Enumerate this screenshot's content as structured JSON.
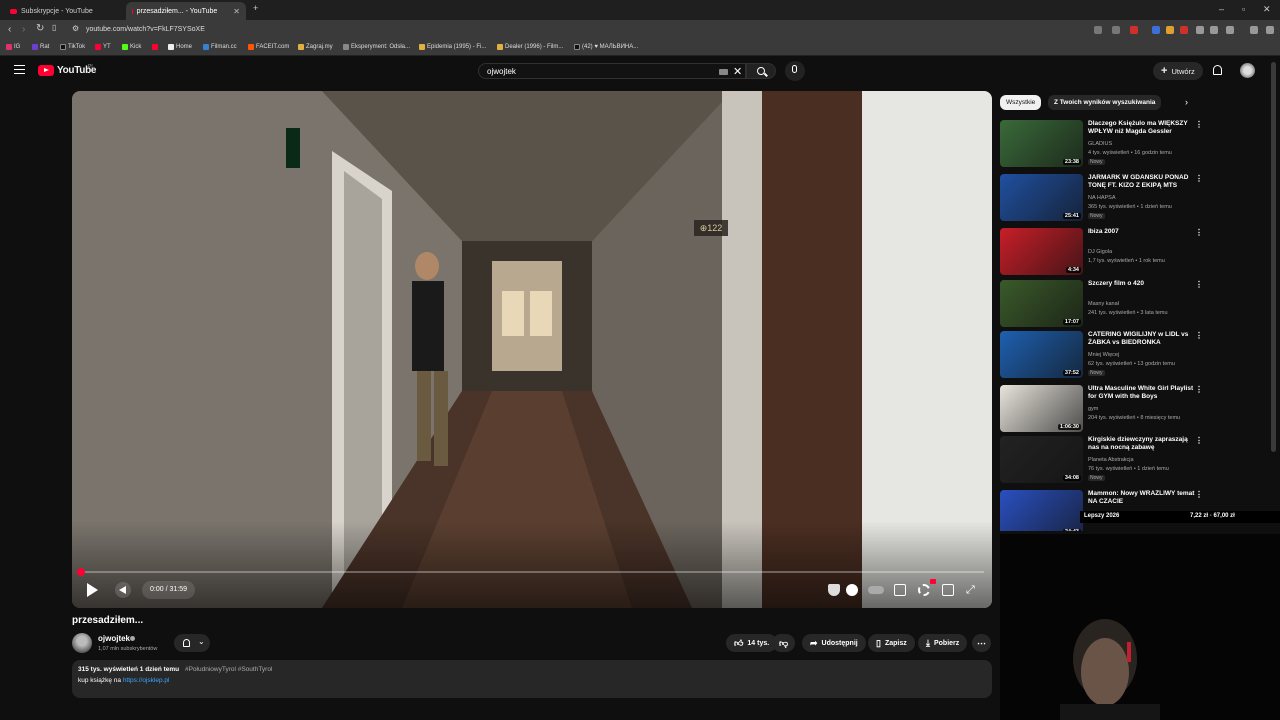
{
  "browser": {
    "tabs": [
      {
        "title": "Subskrypcje - YouTube"
      },
      {
        "title": "przesadziłem... - YouTube"
      }
    ],
    "url": "youtube.com/watch?v=FkLF7SYSoXE",
    "bookmarks": [
      "IG",
      "Rat",
      "TikTok",
      "YT",
      "Kick",
      "Home",
      "Filman.cc",
      "FACEIT.com",
      "Zagraj.my",
      "Eksperyment: Odsła...",
      "Epidemia (1995) - Fi...",
      "Dealer (1996) - Film...",
      "(42) ♥ МАЛЬВИНА..."
    ]
  },
  "header": {
    "logo_text": "YouTube",
    "logo_country": "PL",
    "search_value": "ojwojtek",
    "create_label": "Utwórz"
  },
  "player": {
    "time": "0:00 / 31:59",
    "progress": 0.0,
    "room_sign": "122"
  },
  "video": {
    "title": "przesadziłem...",
    "channel": "ojwojtek",
    "subscribers": "1,07 mln subskrybentów",
    "likes": "14 tys.",
    "share_label": "Udostępnij",
    "save_label": "Zapisz",
    "download_label": "Pobierz",
    "views_date": "315 tys. wyświetleń  1 dzień temu",
    "tags": "#PołudniowyTyrol #SouthTyrol",
    "desc_line": "kup książkę na ",
    "desc_link": "https://ojsklep.pl"
  },
  "sidebar": {
    "chips": [
      "Wszystkie",
      "Z Twoich wyników wyszukiwania"
    ],
    "recommendations": [
      {
        "title": "Dlaczego Księżulo ma WIĘKSZY WPŁYW niż Magda Gessler",
        "channel": "GLADIUS",
        "meta": "4 tys. wyświetleń • 16 godzin temu",
        "badge": "Nowy",
        "duration": "23:38",
        "thumb": "#3a6a3a"
      },
      {
        "title": "JARMARK W GDAŃSKU PONAD TONĘ FT. KIZO Z EKIPĄ MTS",
        "channel": "NA HAPSA",
        "meta": "365 tys. wyświetleń • 1 dzień temu",
        "badge": "Nowy",
        "duration": "25:41",
        "thumb": "#2050a0"
      },
      {
        "title": "Ibiza 2007",
        "channel": "DJ Gigola",
        "meta": "1,7 tys. wyświetleń • 1 rok temu",
        "badge": "",
        "duration": "4:34",
        "thumb": "#c81e28"
      },
      {
        "title": "Szczery film o 420",
        "channel": "Masny kanał",
        "meta": "241 tys. wyświetleń • 3 lata temu",
        "badge": "",
        "duration": "17:07",
        "thumb": "#3a5a2a"
      },
      {
        "title": "CATERING WIGILIJNY w LIDL vs ŻABKA vs BIEDRONKA",
        "channel": "Mniej Więcej",
        "meta": "62 tys. wyświetleń • 13 godzin temu",
        "badge": "Nowy",
        "duration": "37:52",
        "thumb": "#1e60b0"
      },
      {
        "title": "Ultra Masculine White Girl Playlist for GYM with the Boys",
        "channel": "gym",
        "meta": "204 tys. wyświetleń • 8 miesięcy temu",
        "badge": "",
        "duration": "1:06:30",
        "thumb": "#e8e4dc"
      },
      {
        "title": "Kirgiskie dziewczyny zapraszają nas na nocną zabawę",
        "channel": "Planeta Abstrakcja",
        "meta": "76 tys. wyświetleń • 1 dzień temu",
        "badge": "Nowy",
        "duration": "34:08",
        "thumb": "#222222"
      },
      {
        "title": "Mammon: Nowy WRAŻLIWY temat NA CZACIE",
        "channel": "",
        "meta": "",
        "badge": "",
        "duration": "24:43",
        "thumb": "#2a50c0"
      }
    ]
  },
  "overlay": {
    "label": "Lepszy 2026",
    "prices": "7,22 zł  ◦  67,00 zł"
  }
}
